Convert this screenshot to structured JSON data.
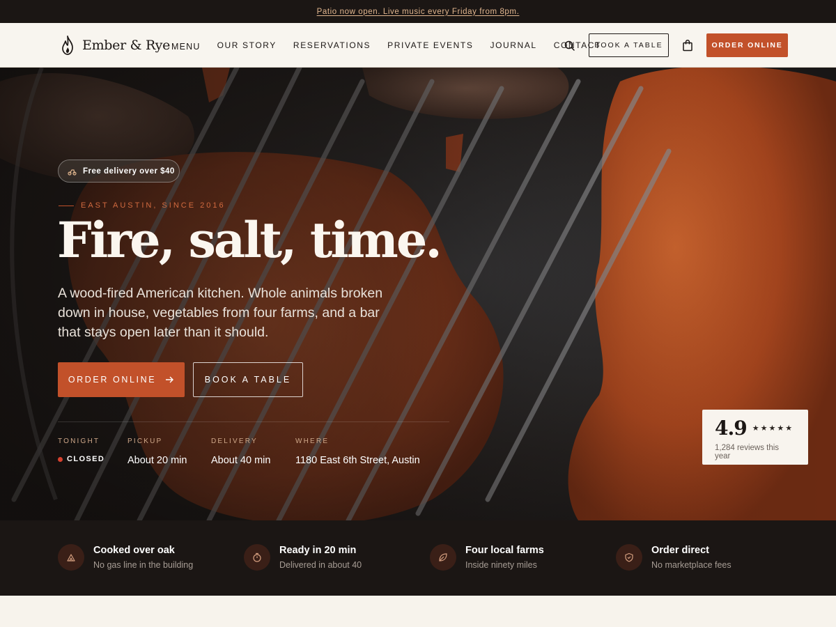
{
  "announcement": "Patio now open. Live music every Friday from 8pm.",
  "brand": {
    "name": "Ember & Rye",
    "accent": "#c2512a",
    "dark": "#1b1614"
  },
  "nav": {
    "menu": "MENU",
    "our_story": "OUR STORY",
    "reservations": "RESERVATIONS",
    "private_events": "PRIVATE EVENTS",
    "journal": "JOURNAL",
    "contact": "CONTACT"
  },
  "header_actions": {
    "search_icon": "search-icon",
    "book": "BOOK A TABLE",
    "bag_icon": "bag-icon",
    "order": "ORDER ONLINE"
  },
  "hero": {
    "pill": "Free delivery over $40",
    "eyebrow": "EAST AUSTIN, SINCE 2016",
    "title": "Fire, salt, time.",
    "description": "A wood-fired American kitchen. Whole animals broken down in house, vegetables from four farms, and a bar that stays open later than it should.",
    "cta_order": "ORDER ONLINE",
    "cta_order_icon": "arrow-right-icon",
    "cta_book": "BOOK A TABLE"
  },
  "stats": [
    {
      "label": "TONIGHT",
      "value": "CLOSED"
    },
    {
      "label": "PICKUP",
      "value": "About 20 min"
    },
    {
      "label": "DELIVERY",
      "value": "About 40 min"
    },
    {
      "label": "WHERE",
      "value": "1180 East 6th Street, Austin"
    }
  ],
  "rating": {
    "score": "4.9",
    "stars": 5,
    "reviews": "1,284 reviews this year"
  },
  "features": [
    {
      "icon": "fire-icon",
      "title": "Cooked over oak",
      "subtitle": "No gas line in the building"
    },
    {
      "icon": "timer-icon",
      "title": "Ready in 20 min",
      "subtitle": "Delivered in about 40"
    },
    {
      "icon": "leaf-icon",
      "title": "Four local farms",
      "subtitle": "Inside ninety miles"
    },
    {
      "icon": "shield-icon",
      "title": "Order direct",
      "subtitle": "No marketplace fees"
    }
  ]
}
